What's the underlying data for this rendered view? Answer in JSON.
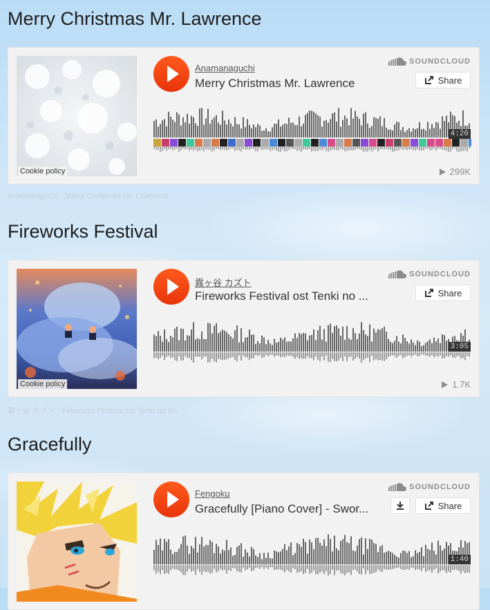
{
  "brand_color": "#f5420e",
  "embeds": [
    {
      "heading": "Merry Christmas Mr. Lawrence",
      "artist": "Anamanaguchi",
      "track": "Merry Christmas Mr. Lawrence",
      "provider": "SOUNDCLOUD",
      "share_label": "Share",
      "duration": "4:20",
      "plays": "299K",
      "cookie": "Cookie policy",
      "byline_artist": "Anamanaguchi",
      "byline_sep": "·",
      "byline_track": "Merry Christmas Mr. Lawrence",
      "artwork": "snow texture",
      "has_comments_strip": true,
      "has_download": false
    },
    {
      "heading": "Fireworks Festival",
      "artist": "霧ヶ谷 カズト",
      "track": "Fireworks Festival ost Tenki no ...",
      "provider": "SOUNDCLOUD",
      "share_label": "Share",
      "duration": "3:05",
      "plays": "1.7K",
      "cookie": "Cookie policy",
      "byline_artist": "霧ヶ谷 カズト",
      "byline_sep": "·",
      "byline_track": "Fireworks Festival ost Tenki no Ko",
      "artwork": "anime illustration with fireworks and clouds",
      "has_comments_strip": false,
      "has_download": false
    },
    {
      "heading": "Gracefully",
      "artist": "Fengoku",
      "track": "Gracefully [Piano Cover] - Swor...",
      "provider": "SOUNDCLOUD",
      "share_label": "Share",
      "duration": "1:40",
      "plays": "",
      "cookie": "",
      "byline_artist": "",
      "byline_sep": "",
      "byline_track": "",
      "artwork": "anime character with spiky blond hair",
      "has_comments_strip": false,
      "has_download": true
    }
  ],
  "icons": {
    "play": "play-icon",
    "share": "share-icon",
    "download": "download-icon",
    "soundcloud": "soundcloud-logo-icon",
    "plays": "play-count-icon"
  }
}
